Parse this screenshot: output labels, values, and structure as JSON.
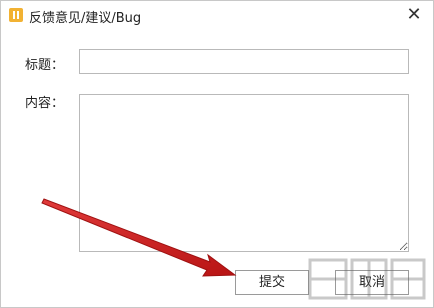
{
  "window": {
    "title": "反馈意见/建议/Bug",
    "close_glyph": "✕"
  },
  "form": {
    "title_label": "标题：",
    "content_label": "内容：",
    "title_value": "",
    "content_value": ""
  },
  "buttons": {
    "submit": "提交",
    "cancel": "取消"
  },
  "colors": {
    "arrow": "#d62222",
    "icon": "#f2b233"
  }
}
